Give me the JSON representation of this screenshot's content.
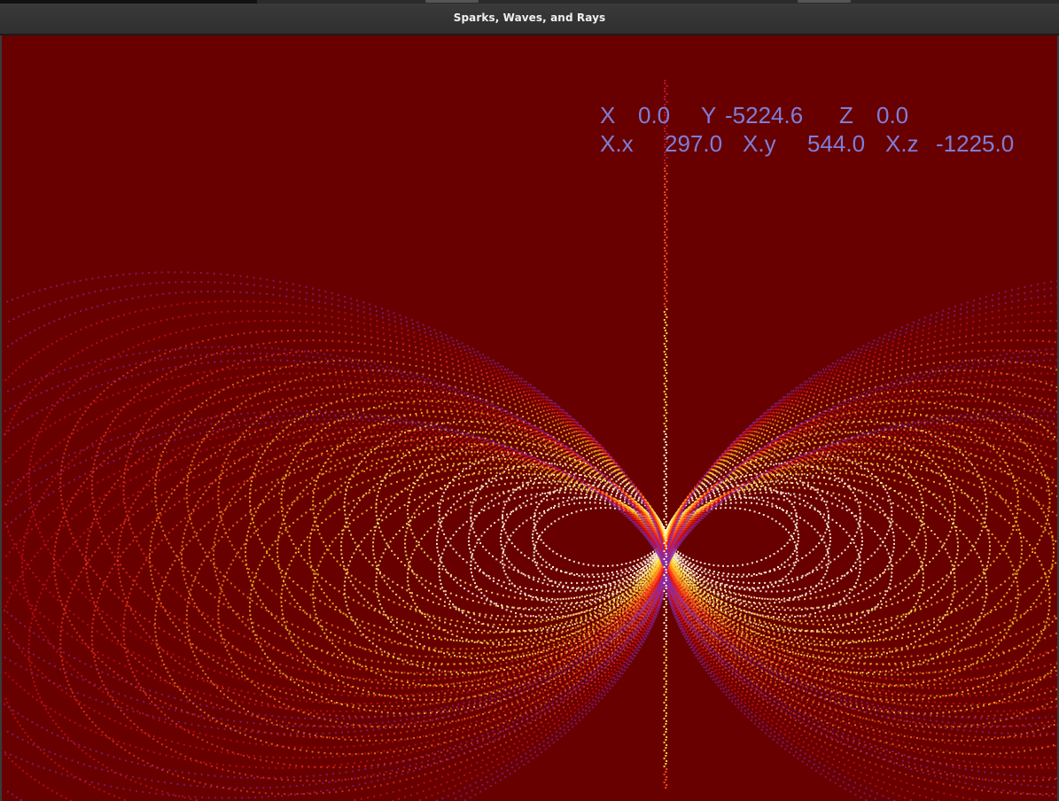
{
  "window": {
    "title": "Sparks, Waves, and Rays"
  },
  "readout": {
    "x_label": "X",
    "x_value": "0.0",
    "y_label": "Y",
    "y_value": "-5224.6",
    "z_label": "Z",
    "z_value": "0.0",
    "xx_label": "X.x",
    "xx_value": "297.0",
    "xy_label": "X.y",
    "xy_value": "544.0",
    "xz_label": "X.z",
    "xz_value": "-1225.0"
  },
  "colors": {
    "background": "#680000",
    "readout_text": "#7e7ed8",
    "titlebar": "#333333"
  }
}
